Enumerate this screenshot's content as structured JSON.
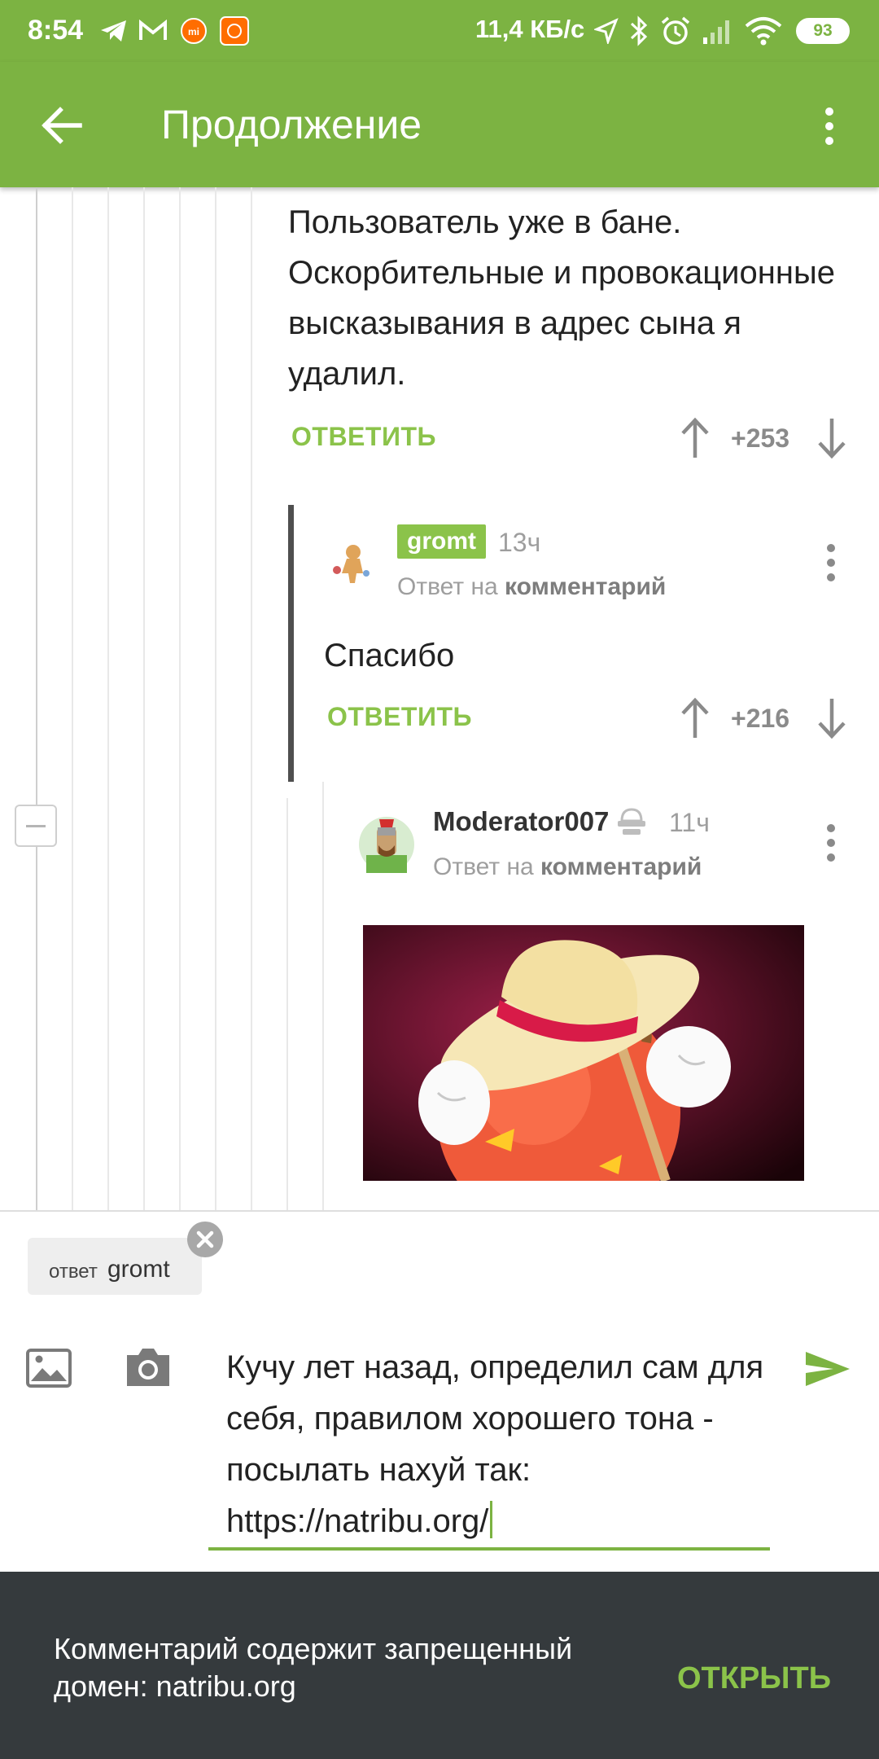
{
  "status_bar": {
    "time": "8:54",
    "network_speed": "11,4 КБ/с",
    "battery": "93",
    "icons": [
      "telegram-icon",
      "gmail-icon",
      "mi-icon",
      "mi-icon",
      "location-icon",
      "bluetooth-icon",
      "alarm-icon",
      "signal-icon",
      "wifi-icon",
      "battery-icon"
    ]
  },
  "app_bar": {
    "title": "Продолжение",
    "back_icon": "arrow-left-icon",
    "menu_icon": "more-vert-icon"
  },
  "comments": [
    {
      "text": "Пользователь уже в бане. Оскорбительные и провокационные высказывания в адрес сына я удалил.",
      "reply_label": "ОТВЕТИТЬ",
      "score": "+253"
    },
    {
      "author": "gromt",
      "time": "13ч",
      "reply_to_prefix": "Ответ на",
      "reply_to_link": "комментарий",
      "text": "Спасибо",
      "reply_label": "ОТВЕТИТЬ",
      "score": "+216"
    },
    {
      "author": "Moderator007",
      "time": "11ч",
      "reply_to_prefix": "Ответ на",
      "reply_to_link": "комментарий"
    }
  ],
  "compose": {
    "reply_chip_label": "ответ",
    "reply_chip_name": "gromt",
    "input_value": "Кучу лет назад, определил сам для себя, правилом хорошего тона - посылать нахуй так: https://natribu.org/",
    "accent": "#7cb342"
  },
  "snackbar": {
    "message": "Комментарий содержит запрещенный домен: natribu.org",
    "action": "ОТКРЫТЬ"
  },
  "colors": {
    "primary": "#7cb342",
    "accent": "#8bc34a",
    "snackbar_bg": "#353a3d"
  }
}
